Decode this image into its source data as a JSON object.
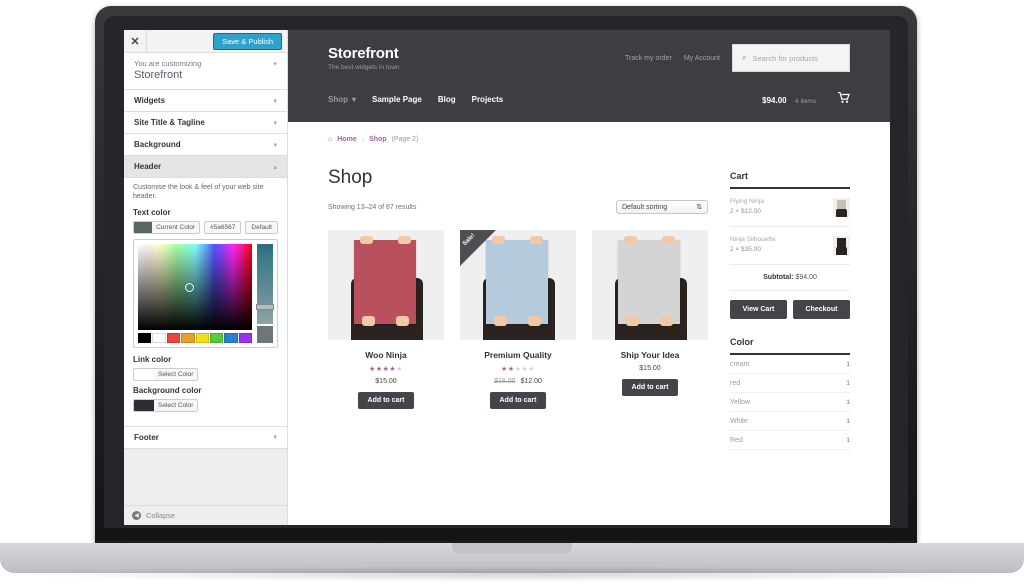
{
  "customizer": {
    "close_icon": "✕",
    "save_button": "Save & Publish",
    "you_are_customizing_label": "You are customizing",
    "theme_name": "Storefront",
    "sections": [
      {
        "label": "Widgets",
        "caret": "▾"
      },
      {
        "label": "Site Title & Tagline",
        "caret": "▾"
      },
      {
        "label": "Background",
        "caret": "▾"
      }
    ],
    "header_section": {
      "label": "Header",
      "caret": "▴"
    },
    "header_description": "Customise the look & feel of your web site header.",
    "text_color": {
      "label": "Text color",
      "current_color_label": "Current Color",
      "hex": "#5a6567",
      "default_label": "Default",
      "swatch": "#5a6567"
    },
    "palette": [
      "#000000",
      "#ffffff",
      "#e8453c",
      "#e0a229",
      "#f0e11f",
      "#5cc93f",
      "#2a7fd0",
      "#9b30ee"
    ],
    "link_color": {
      "label": "Link color",
      "button_label": "Select Color",
      "swatch": "#ffffff"
    },
    "background_color": {
      "label": "Background color",
      "button_label": "Select Color",
      "swatch": "#2b2d33"
    },
    "footer_section": {
      "label": "Footer",
      "caret": "▾"
    },
    "collapse_label": "Collapse",
    "collapse_icon": "◀",
    "accent_color": "#2ea2cc"
  },
  "site": {
    "brand_title": "Storefront",
    "brand_tagline": "The best widgets in town",
    "secondary_links": [
      "Track my order",
      "My Account"
    ],
    "search": {
      "placeholder": "Search for products",
      "icon": "⌕"
    },
    "nav": [
      {
        "label": "Shop",
        "muted": true,
        "caret": "▾"
      },
      {
        "label": "Sample Page",
        "muted": false
      },
      {
        "label": "Blog",
        "muted": false
      },
      {
        "label": "Projects",
        "muted": false
      }
    ],
    "cart_summary": {
      "amount": "$94.00",
      "count": "4 items",
      "icon": "🛒"
    },
    "header_bg": "#3d3d42",
    "breadcrumb": {
      "home_icon": "⌂",
      "home": "Home",
      "sep": "›",
      "shop": "Shop",
      "current": "(Page 2)"
    },
    "shop": {
      "title": "Shop",
      "result_count": "Showing 13–24 of 87 results",
      "sorting": {
        "value": "Default sorting",
        "caret": "⇅"
      },
      "products": [
        {
          "title": "Woo Ninja",
          "rating_filled": 4,
          "rating_total": 5,
          "price": "$15.00",
          "old_price": "",
          "add_to_cart": "Add to cart",
          "on_sale": false,
          "sale_label": "",
          "poster_color": "#b8505e"
        },
        {
          "title": "Premium Quality",
          "rating_filled": 2,
          "rating_total": 5,
          "price": "$12.00",
          "old_price": "$16.00",
          "add_to_cart": "Add to cart",
          "on_sale": true,
          "sale_label": "Sale!",
          "poster_color": "#b3cbdc"
        },
        {
          "title": "Ship Your Idea",
          "rating_filled": 0,
          "rating_total": 0,
          "price": "$15.00",
          "old_price": "",
          "add_to_cart": "Add to cart",
          "on_sale": false,
          "sale_label": "",
          "poster_color": "#d4d4d4"
        }
      ]
    },
    "cart_widget": {
      "title": "Cart",
      "items": [
        {
          "name": "Flying Ninja",
          "qty": "2 × $12.00",
          "thumb_color": "#c8c0b4"
        },
        {
          "name": "Ninja Silhouette",
          "qty": "2 × $35.00",
          "thumb_color": "#2b2320"
        }
      ],
      "subtotal_label": "Subtotal:",
      "subtotal_value": "$94.00",
      "view_cart": "View Cart",
      "checkout": "Checkout"
    },
    "color_widget": {
      "title": "Color",
      "filters": [
        {
          "name": "cream",
          "count": "1"
        },
        {
          "name": "red",
          "count": "1"
        },
        {
          "name": "Yellow",
          "count": "1"
        },
        {
          "name": "White",
          "count": "1"
        },
        {
          "name": "Red",
          "count": "1"
        }
      ]
    }
  }
}
